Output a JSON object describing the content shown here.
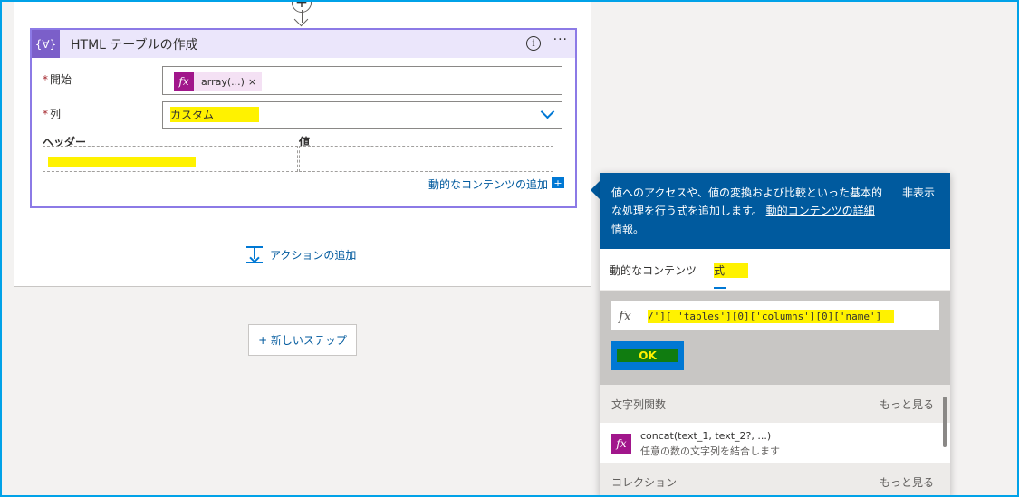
{
  "card": {
    "title": "HTML テーブルの作成",
    "icon_text": "{∀}",
    "info_icon": "i",
    "more_icon": "···",
    "start_label": "開始",
    "start_token": "array(...)",
    "token_remove": "×",
    "columns_label": "列",
    "columns_value": "カスタム",
    "header_label": "ヘッダー",
    "value_label": "値",
    "dynamic_content_link": "動的なコンテンツの追加",
    "dynamic_plus": "+",
    "required_mark": "*"
  },
  "add_action_label": "アクションの追加",
  "new_step_label": "+ 新しいステップ",
  "panel": {
    "description": "値へのアクセスや、値の変換および比較といった基本的な処理を行う式を追加します。",
    "link_text": "動的コンテンツの詳細情報。",
    "hide_label": "非表示",
    "tabs": [
      "動的なコンテンツ",
      "式"
    ],
    "expression_fx": "fx",
    "expression_value": "/'][ 'tables'][0]['columns'][0]['name']",
    "ok_label": "OK",
    "sections": [
      {
        "title": "文字列関数",
        "more": "もっと見る",
        "items": [
          {
            "name": "concat(text_1, text_2?, ...)",
            "description": "任意の数の文字列を結合します"
          }
        ]
      },
      {
        "title": "コレクション",
        "more": "もっと見る"
      }
    ]
  },
  "colors": {
    "accent": "#0078d4",
    "panel_header": "#005a9e",
    "card_border": "#8c7ae6",
    "card_icon": "#7b5fc9",
    "function_token": "#a1168b",
    "highlight": "#fff200",
    "ok_highlight": "#107c10"
  },
  "icons": {
    "plus": "plus-circle-icon",
    "arrow": "arrow-down-icon",
    "chevron": "chevron-down-icon",
    "add_action": "add-action-icon"
  }
}
